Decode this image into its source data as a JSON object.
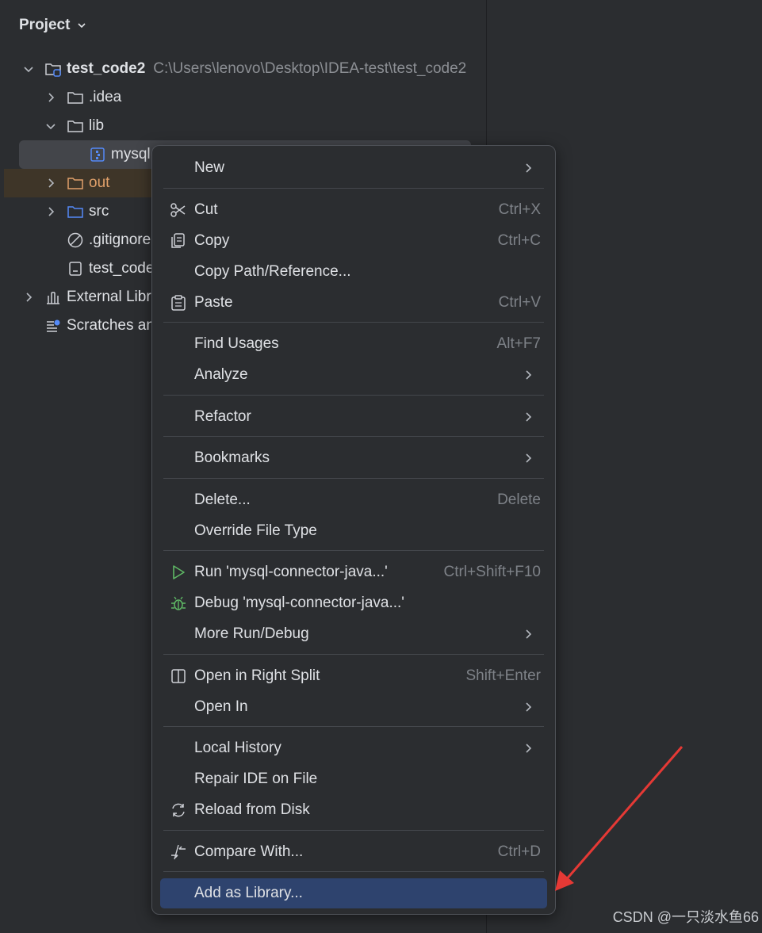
{
  "project_panel": {
    "title": "Project",
    "tree": [
      {
        "label": "test_code2",
        "path": "C:\\Users\\lenovo\\Desktop\\IDEA-test\\test_code2"
      },
      {
        "label": ".idea"
      },
      {
        "label": "lib"
      },
      {
        "label": "mysql"
      },
      {
        "label": "out"
      },
      {
        "label": "src"
      },
      {
        "label": ".gitignore"
      },
      {
        "label": "test_code"
      },
      {
        "label": "External Libr"
      },
      {
        "label": "Scratches an"
      }
    ]
  },
  "context_menu": {
    "items": [
      {
        "label": "New",
        "shortcut": "",
        "submenu": true,
        "icon": ""
      },
      {
        "label": "Cut",
        "shortcut": "Ctrl+X",
        "submenu": false,
        "icon": "scissors-icon"
      },
      {
        "label": "Copy",
        "shortcut": "Ctrl+C",
        "submenu": false,
        "icon": "copy-icon"
      },
      {
        "label": "Copy Path/Reference...",
        "shortcut": "",
        "submenu": false,
        "icon": ""
      },
      {
        "label": "Paste",
        "shortcut": "Ctrl+V",
        "submenu": false,
        "icon": "paste-icon"
      },
      {
        "label": "Find Usages",
        "shortcut": "Alt+F7",
        "submenu": false,
        "icon": ""
      },
      {
        "label": "Analyze",
        "shortcut": "",
        "submenu": true,
        "icon": ""
      },
      {
        "label": "Refactor",
        "shortcut": "",
        "submenu": true,
        "icon": ""
      },
      {
        "label": "Bookmarks",
        "shortcut": "",
        "submenu": true,
        "icon": ""
      },
      {
        "label": "Delete...",
        "shortcut": "Delete",
        "submenu": false,
        "icon": ""
      },
      {
        "label": "Override File Type",
        "shortcut": "",
        "submenu": false,
        "icon": ""
      },
      {
        "label": "Run 'mysql-connector-java...'",
        "shortcut": "Ctrl+Shift+F10",
        "submenu": false,
        "icon": "run-icon"
      },
      {
        "label": "Debug 'mysql-connector-java...'",
        "shortcut": "",
        "submenu": false,
        "icon": "debug-icon"
      },
      {
        "label": "More Run/Debug",
        "shortcut": "",
        "submenu": true,
        "icon": ""
      },
      {
        "label": "Open in Right Split",
        "shortcut": "Shift+Enter",
        "submenu": false,
        "icon": "split-icon"
      },
      {
        "label": "Open In",
        "shortcut": "",
        "submenu": true,
        "icon": ""
      },
      {
        "label": "Local History",
        "shortcut": "",
        "submenu": true,
        "icon": ""
      },
      {
        "label": "Repair IDE on File",
        "shortcut": "",
        "submenu": false,
        "icon": ""
      },
      {
        "label": "Reload from Disk",
        "shortcut": "",
        "submenu": false,
        "icon": "reload-icon"
      },
      {
        "label": "Compare With...",
        "shortcut": "Ctrl+D",
        "submenu": false,
        "icon": "compare-icon"
      },
      {
        "label": "Add as Library...",
        "shortcut": "",
        "submenu": false,
        "icon": ""
      }
    ]
  },
  "watermark": "CSDN @一只淡水鱼66",
  "colors": {
    "background": "#2b2d30",
    "menu_highlight": "#2e436e",
    "text": "#dfe1e5",
    "shortcut_text": "#7e8288",
    "arrow_annotation": "#e53935",
    "run_green": "#5fb865",
    "folder_blue": "#548af7",
    "excluded_orange": "#e0a06a"
  }
}
